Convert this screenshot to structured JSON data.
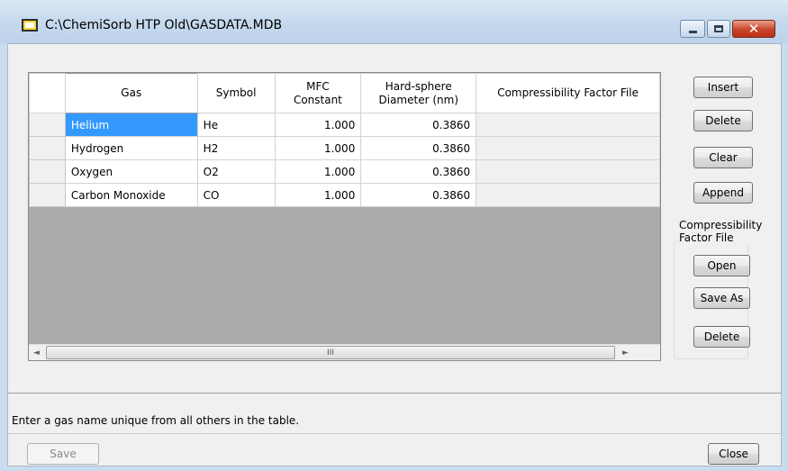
{
  "window": {
    "title": "C:\\ChemiSorb HTP Old\\GASDATA.MDB",
    "title_icon": "app-window-icon",
    "controls": {
      "minimize": "minimize-icon",
      "maximize": "maximize-icon",
      "close": "close-icon"
    }
  },
  "grid": {
    "columns": [
      {
        "line1": "Gas",
        "line2": ""
      },
      {
        "line1": "Symbol",
        "line2": ""
      },
      {
        "line1": "MFC",
        "line2": "Constant"
      },
      {
        "line1": "Hard-sphere",
        "line2": "Diameter (nm)"
      },
      {
        "line1": "Compressibility Factor File",
        "line2": ""
      }
    ],
    "rows": [
      {
        "gas": "Helium",
        "symbol": "He",
        "mfc": "1.000",
        "diameter": "0.3860",
        "cff": ""
      },
      {
        "gas": "Hydrogen",
        "symbol": "H2",
        "mfc": "1.000",
        "diameter": "0.3860",
        "cff": ""
      },
      {
        "gas": "Oxygen",
        "symbol": "O2",
        "mfc": "1.000",
        "diameter": "0.3860",
        "cff": ""
      },
      {
        "gas": "Carbon Monoxide",
        "symbol": "CO",
        "mfc": "1.000",
        "diameter": "0.3860",
        "cff": ""
      }
    ],
    "selected_cell": "Helium",
    "scrollbar": {
      "grip": "III",
      "left_arrow": "◄",
      "right_arrow": "►"
    }
  },
  "buttons": {
    "insert": "Insert",
    "delete": "Delete",
    "clear": "Clear",
    "append": "Append",
    "cff_open": "Open",
    "cff_save_as": "Save As",
    "cff_delete": "Delete",
    "save": "Save",
    "close": "Close"
  },
  "cff_group": {
    "line1": "Compressibility",
    "line2": "Factor File"
  },
  "status": {
    "text": "Enter a gas name unique from all others in the table."
  },
  "colors": {
    "selection": "#3399ff",
    "grid_background": "#ababab",
    "close_button": "#c8452b"
  }
}
